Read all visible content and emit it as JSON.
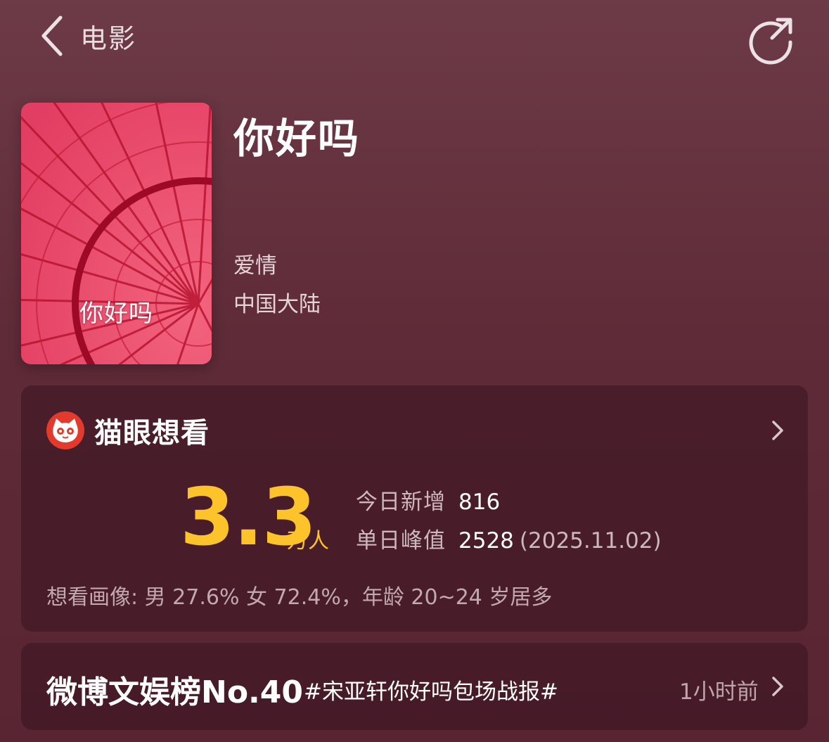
{
  "header": {
    "back_label": "电影"
  },
  "movie": {
    "poster_text": "你好吗",
    "title": "你好吗",
    "genre": "爱情",
    "region": "中国大陆"
  },
  "want": {
    "title": "猫眼想看",
    "count": "3.3",
    "unit": "万人",
    "today_label": "今日新增",
    "today_value": "816",
    "peak_label": "单日峰值",
    "peak_value": "2528",
    "peak_date": "(2025.11.02)",
    "portrait": "想看画像: 男 27.6%  女 72.4%，年龄 20~24 岁居多"
  },
  "weibo": {
    "rank": "微博文娱榜No.40",
    "tag": "#宋亚轩你好吗包场战报#",
    "time": "1小时前"
  },
  "colors": {
    "accent": "#fcc42a",
    "background": "#5f2b38",
    "maoyan_red": "#e23b2d"
  },
  "icons": [
    "back-arrow-icon",
    "share-icon",
    "maoyan-cat-icon",
    "chevron-right-icon"
  ]
}
